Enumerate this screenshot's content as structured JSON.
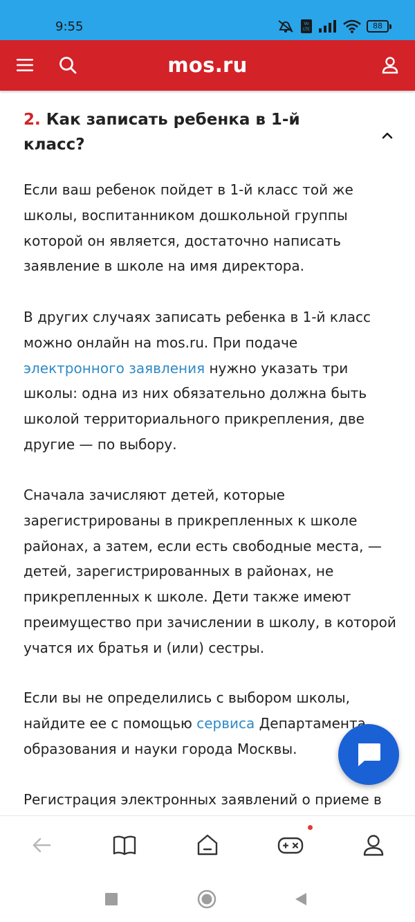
{
  "status_bar": {
    "time": "9:55",
    "battery": "88",
    "lte_label": "LTE",
    "vo_label": "Vo"
  },
  "header": {
    "title": "mos.ru"
  },
  "section": {
    "number": "2.",
    "title": "Как записать ребенка в 1-й класс?"
  },
  "paragraphs": {
    "p1": "Если ваш ребенок пойдет в 1-й класс той же школы, воспитанником дошкольной группы которой он является, достаточно написать заявление в школе на имя директора.",
    "p2_before": "В других случаях записать ребенка в 1-й класс можно онлайн на mos.ru. При подаче ",
    "p2_link": "электронного заявления",
    "p2_after": " нужно указать три школы: одна из них обязательно должна быть школой территориального прикрепления, две другие — по выбору.",
    "p3": "Сначала зачисляют детей, которые зарегистрированы в прикрепленных к школе районах, а затем, если есть свободные места, — детей, зарегистрированных в районах, не прикрепленных к школе. Дети также имеют преимущество при зачислении в школу, в которой учатся их братья и (или) сестры.",
    "p4_before": "Если вы не определились с выбором школы, найдите ее с помощью ",
    "p4_link": "сервиса",
    "p4_after": " Департамента образования и науки города Москвы.",
    "p5": "Регистрация электронных заявлений о приеме в"
  },
  "colors": {
    "brand_red": "#d32228",
    "status_blue": "#2aa5ea",
    "link_blue": "#2f8ac6",
    "fab_blue": "#1b61d6"
  },
  "icons": {
    "menu": "hamburger-icon",
    "search": "search-icon",
    "profile": "user-icon",
    "collapse": "chevron-up-icon",
    "chat": "chat-bubble-icon"
  }
}
